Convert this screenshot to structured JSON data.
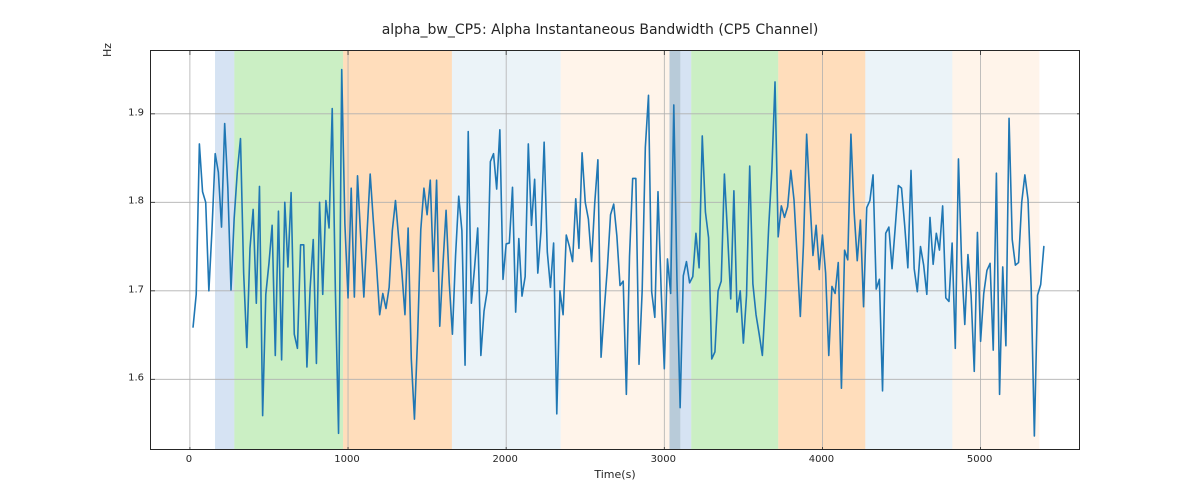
{
  "chart_data": {
    "type": "line",
    "title": "alpha_bw_CP5: Alpha Instantaneous Bandwidth (CP5 Channel)",
    "xlabel": "Time(s)",
    "ylabel": "Hz",
    "xlim": [
      -245.95,
      5634.95
    ],
    "ylim": [
      1.519,
      1.971
    ],
    "xticks": [
      0,
      1000,
      2000,
      3000,
      4000,
      5000
    ],
    "yticks": [
      1.6,
      1.7,
      1.8,
      1.9
    ],
    "line_color": "#1f77b4",
    "grid_color": "#b0b0b0",
    "bands": [
      {
        "x0": 158.92,
        "x1": 280.97,
        "color": "#aec7e8",
        "alpha": 0.5
      },
      {
        "x0": 280.97,
        "x1": 968.91,
        "color": "#98df8a",
        "alpha": 0.5
      },
      {
        "x0": 968.91,
        "x1": 1656.85,
        "color": "#ffbb78",
        "alpha": 0.5
      },
      {
        "x0": 1656.85,
        "x1": 2344.79,
        "color": "#c6dcec",
        "alpha": 0.35
      },
      {
        "x0": 2344.79,
        "x1": 3032.73,
        "color": "#ffe0c2",
        "alpha": 0.35
      },
      {
        "x0": 3032.73,
        "x1": 3101.52,
        "color": "#88a8c0",
        "alpha": 0.6
      },
      {
        "x0": 3101.52,
        "x1": 3170.32,
        "color": "#aec7e8",
        "alpha": 0.5
      },
      {
        "x0": 3170.32,
        "x1": 3720.67,
        "color": "#98df8a",
        "alpha": 0.5
      },
      {
        "x0": 3720.67,
        "x1": 4271.02,
        "color": "#ffbb78",
        "alpha": 0.5
      },
      {
        "x0": 4271.02,
        "x1": 4821.38,
        "color": "#c6dcec",
        "alpha": 0.35
      },
      {
        "x0": 4821.38,
        "x1": 5371.73,
        "color": "#ffe0c2",
        "alpha": 0.35
      }
    ],
    "series": [
      {
        "name": "alpha_bw_CP5",
        "x_start": 20,
        "x_step": 20,
        "values": [
          1.659,
          1.696,
          1.866,
          1.812,
          1.8,
          1.7,
          1.77,
          1.855,
          1.834,
          1.772,
          1.889,
          1.816,
          1.701,
          1.782,
          1.835,
          1.872,
          1.72,
          1.636,
          1.748,
          1.792,
          1.686,
          1.818,
          1.559,
          1.696,
          1.731,
          1.774,
          1.627,
          1.79,
          1.622,
          1.8,
          1.727,
          1.811,
          1.651,
          1.635,
          1.752,
          1.752,
          1.614,
          1.702,
          1.758,
          1.618,
          1.8,
          1.696,
          1.802,
          1.771,
          1.906,
          1.7,
          1.539,
          1.95,
          1.776,
          1.692,
          1.816,
          1.693,
          1.83,
          1.761,
          1.693,
          1.765,
          1.832,
          1.779,
          1.729,
          1.673,
          1.697,
          1.68,
          1.704,
          1.768,
          1.802,
          1.76,
          1.722,
          1.673,
          1.771,
          1.623,
          1.555,
          1.648,
          1.769,
          1.816,
          1.786,
          1.825,
          1.722,
          1.825,
          1.66,
          1.729,
          1.791,
          1.709,
          1.651,
          1.74,
          1.807,
          1.768,
          1.616,
          1.88,
          1.686,
          1.726,
          1.771,
          1.627,
          1.677,
          1.7,
          1.846,
          1.855,
          1.815,
          1.882,
          1.713,
          1.753,
          1.754,
          1.817,
          1.676,
          1.759,
          1.694,
          1.716,
          1.866,
          1.774,
          1.826,
          1.72,
          1.767,
          1.868,
          1.744,
          1.704,
          1.754,
          1.561,
          1.7,
          1.673,
          1.763,
          1.75,
          1.733,
          1.804,
          1.748,
          1.856,
          1.8,
          1.781,
          1.733,
          1.799,
          1.848,
          1.625,
          1.678,
          1.726,
          1.786,
          1.798,
          1.762,
          1.706,
          1.711,
          1.583,
          1.739,
          1.827,
          1.827,
          1.617,
          1.7,
          1.862,
          1.921,
          1.699,
          1.67,
          1.812,
          1.701,
          1.612,
          1.736,
          1.697,
          1.91,
          1.712,
          1.568,
          1.717,
          1.733,
          1.709,
          1.716,
          1.765,
          1.726,
          1.875,
          1.789,
          1.76,
          1.623,
          1.631,
          1.7,
          1.711,
          1.832,
          1.764,
          1.691,
          1.813,
          1.676,
          1.7,
          1.641,
          1.695,
          1.841,
          1.708,
          1.673,
          1.651,
          1.627,
          1.692,
          1.772,
          1.836,
          1.936,
          1.761,
          1.796,
          1.783,
          1.795,
          1.836,
          1.803,
          1.738,
          1.671,
          1.752,
          1.877,
          1.805,
          1.74,
          1.774,
          1.724,
          1.763,
          1.72,
          1.627,
          1.705,
          1.697,
          1.732,
          1.59,
          1.746,
          1.735,
          1.877,
          1.79,
          1.734,
          1.78,
          1.682,
          1.794,
          1.802,
          1.831,
          1.702,
          1.713,
          1.587,
          1.765,
          1.772,
          1.725,
          1.771,
          1.819,
          1.816,
          1.774,
          1.726,
          1.836,
          1.725,
          1.699,
          1.75,
          1.729,
          1.696,
          1.783,
          1.73,
          1.765,
          1.746,
          1.796,
          1.692,
          1.688,
          1.754,
          1.635,
          1.849,
          1.731,
          1.662,
          1.741,
          1.695,
          1.609,
          1.766,
          1.643,
          1.697,
          1.723,
          1.731,
          1.633,
          1.833,
          1.583,
          1.727,
          1.638,
          1.895,
          1.758,
          1.729,
          1.732,
          1.8,
          1.831,
          1.803,
          1.703,
          1.536,
          1.695,
          1.707,
          1.75
        ]
      }
    ]
  }
}
